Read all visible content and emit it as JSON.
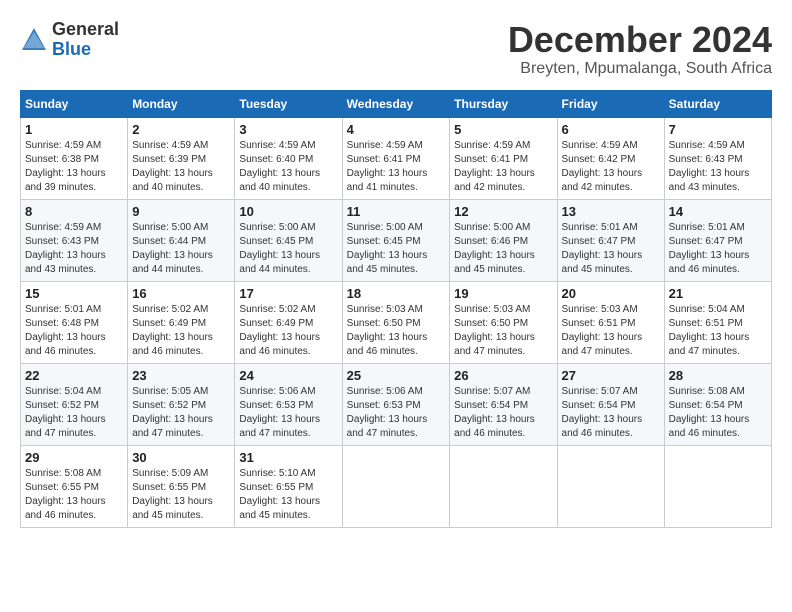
{
  "logo": {
    "general": "General",
    "blue": "Blue"
  },
  "title": "December 2024",
  "subtitle": "Breyten, Mpumalanga, South Africa",
  "headers": [
    "Sunday",
    "Monday",
    "Tuesday",
    "Wednesday",
    "Thursday",
    "Friday",
    "Saturday"
  ],
  "weeks": [
    [
      {
        "day": "1",
        "sunrise": "4:59 AM",
        "sunset": "6:38 PM",
        "daylight": "13 hours and 39 minutes."
      },
      {
        "day": "2",
        "sunrise": "4:59 AM",
        "sunset": "6:39 PM",
        "daylight": "13 hours and 40 minutes."
      },
      {
        "day": "3",
        "sunrise": "4:59 AM",
        "sunset": "6:40 PM",
        "daylight": "13 hours and 40 minutes."
      },
      {
        "day": "4",
        "sunrise": "4:59 AM",
        "sunset": "6:41 PM",
        "daylight": "13 hours and 41 minutes."
      },
      {
        "day": "5",
        "sunrise": "4:59 AM",
        "sunset": "6:41 PM",
        "daylight": "13 hours and 42 minutes."
      },
      {
        "day": "6",
        "sunrise": "4:59 AM",
        "sunset": "6:42 PM",
        "daylight": "13 hours and 42 minutes."
      },
      {
        "day": "7",
        "sunrise": "4:59 AM",
        "sunset": "6:43 PM",
        "daylight": "13 hours and 43 minutes."
      }
    ],
    [
      {
        "day": "8",
        "sunrise": "4:59 AM",
        "sunset": "6:43 PM",
        "daylight": "13 hours and 43 minutes."
      },
      {
        "day": "9",
        "sunrise": "5:00 AM",
        "sunset": "6:44 PM",
        "daylight": "13 hours and 44 minutes."
      },
      {
        "day": "10",
        "sunrise": "5:00 AM",
        "sunset": "6:45 PM",
        "daylight": "13 hours and 44 minutes."
      },
      {
        "day": "11",
        "sunrise": "5:00 AM",
        "sunset": "6:45 PM",
        "daylight": "13 hours and 45 minutes."
      },
      {
        "day": "12",
        "sunrise": "5:00 AM",
        "sunset": "6:46 PM",
        "daylight": "13 hours and 45 minutes."
      },
      {
        "day": "13",
        "sunrise": "5:01 AM",
        "sunset": "6:47 PM",
        "daylight": "13 hours and 45 minutes."
      },
      {
        "day": "14",
        "sunrise": "5:01 AM",
        "sunset": "6:47 PM",
        "daylight": "13 hours and 46 minutes."
      }
    ],
    [
      {
        "day": "15",
        "sunrise": "5:01 AM",
        "sunset": "6:48 PM",
        "daylight": "13 hours and 46 minutes."
      },
      {
        "day": "16",
        "sunrise": "5:02 AM",
        "sunset": "6:49 PM",
        "daylight": "13 hours and 46 minutes."
      },
      {
        "day": "17",
        "sunrise": "5:02 AM",
        "sunset": "6:49 PM",
        "daylight": "13 hours and 46 minutes."
      },
      {
        "day": "18",
        "sunrise": "5:03 AM",
        "sunset": "6:50 PM",
        "daylight": "13 hours and 46 minutes."
      },
      {
        "day": "19",
        "sunrise": "5:03 AM",
        "sunset": "6:50 PM",
        "daylight": "13 hours and 47 minutes."
      },
      {
        "day": "20",
        "sunrise": "5:03 AM",
        "sunset": "6:51 PM",
        "daylight": "13 hours and 47 minutes."
      },
      {
        "day": "21",
        "sunrise": "5:04 AM",
        "sunset": "6:51 PM",
        "daylight": "13 hours and 47 minutes."
      }
    ],
    [
      {
        "day": "22",
        "sunrise": "5:04 AM",
        "sunset": "6:52 PM",
        "daylight": "13 hours and 47 minutes."
      },
      {
        "day": "23",
        "sunrise": "5:05 AM",
        "sunset": "6:52 PM",
        "daylight": "13 hours and 47 minutes."
      },
      {
        "day": "24",
        "sunrise": "5:06 AM",
        "sunset": "6:53 PM",
        "daylight": "13 hours and 47 minutes."
      },
      {
        "day": "25",
        "sunrise": "5:06 AM",
        "sunset": "6:53 PM",
        "daylight": "13 hours and 47 minutes."
      },
      {
        "day": "26",
        "sunrise": "5:07 AM",
        "sunset": "6:54 PM",
        "daylight": "13 hours and 46 minutes."
      },
      {
        "day": "27",
        "sunrise": "5:07 AM",
        "sunset": "6:54 PM",
        "daylight": "13 hours and 46 minutes."
      },
      {
        "day": "28",
        "sunrise": "5:08 AM",
        "sunset": "6:54 PM",
        "daylight": "13 hours and 46 minutes."
      }
    ],
    [
      {
        "day": "29",
        "sunrise": "5:08 AM",
        "sunset": "6:55 PM",
        "daylight": "13 hours and 46 minutes."
      },
      {
        "day": "30",
        "sunrise": "5:09 AM",
        "sunset": "6:55 PM",
        "daylight": "13 hours and 45 minutes."
      },
      {
        "day": "31",
        "sunrise": "5:10 AM",
        "sunset": "6:55 PM",
        "daylight": "13 hours and 45 minutes."
      },
      null,
      null,
      null,
      null
    ]
  ],
  "labels": {
    "sunrise": "Sunrise: ",
    "sunset": "Sunset: ",
    "daylight": "Daylight: "
  }
}
